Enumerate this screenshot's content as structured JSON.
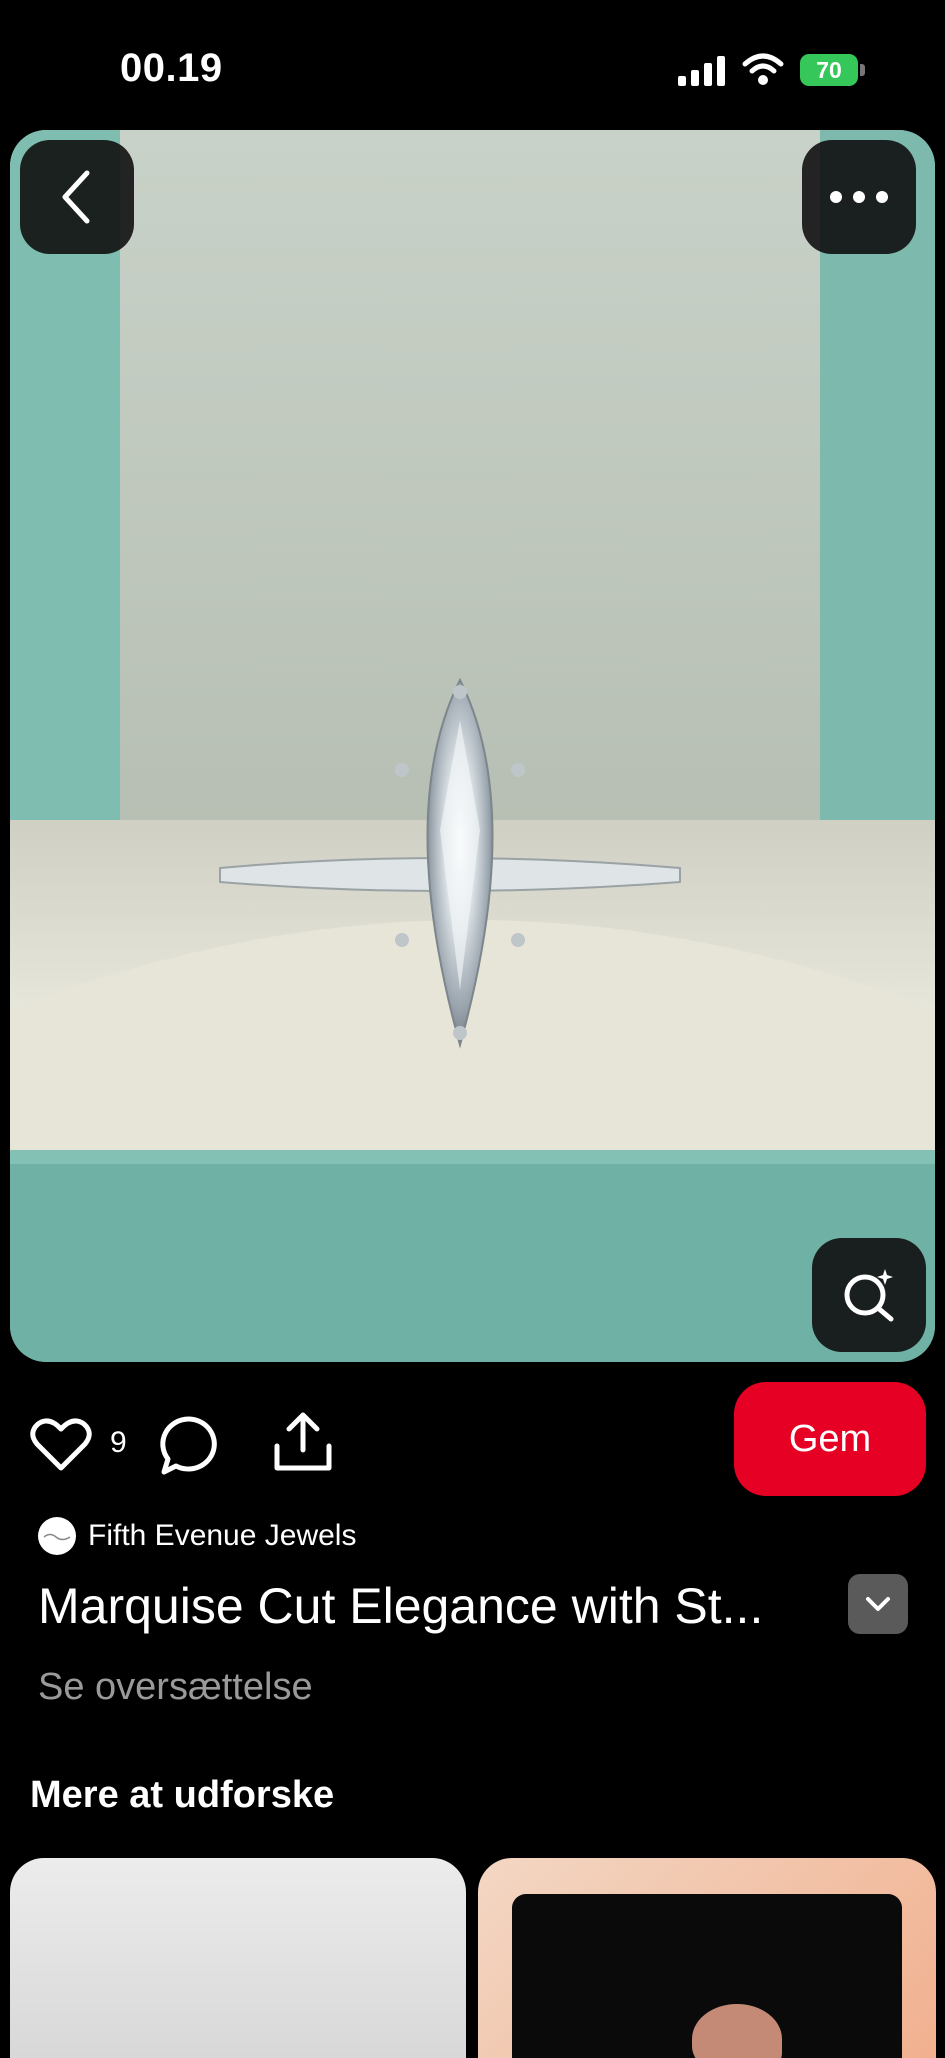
{
  "status_bar": {
    "time": "00.19",
    "battery_level": "70",
    "battery_color": "#35c759",
    "icons": [
      "signal-icon",
      "wifi-icon",
      "battery-icon"
    ]
  },
  "pin": {
    "image_alt": "Marquise cut diamond ring in turquoise box",
    "back_icon": "chevron-left-icon",
    "more_icon": "more-horizontal-icon",
    "lens_icon": "visual-search-icon"
  },
  "actions": {
    "like_count": "9",
    "save_label": "Gem",
    "save_color": "#e60023"
  },
  "creator": {
    "name": "Fifth Evenue Jewels"
  },
  "title": "Marquise Cut Elegance with St...",
  "translate_label": "Se oversættelse",
  "more_section": {
    "title": "Mere at udforske"
  }
}
